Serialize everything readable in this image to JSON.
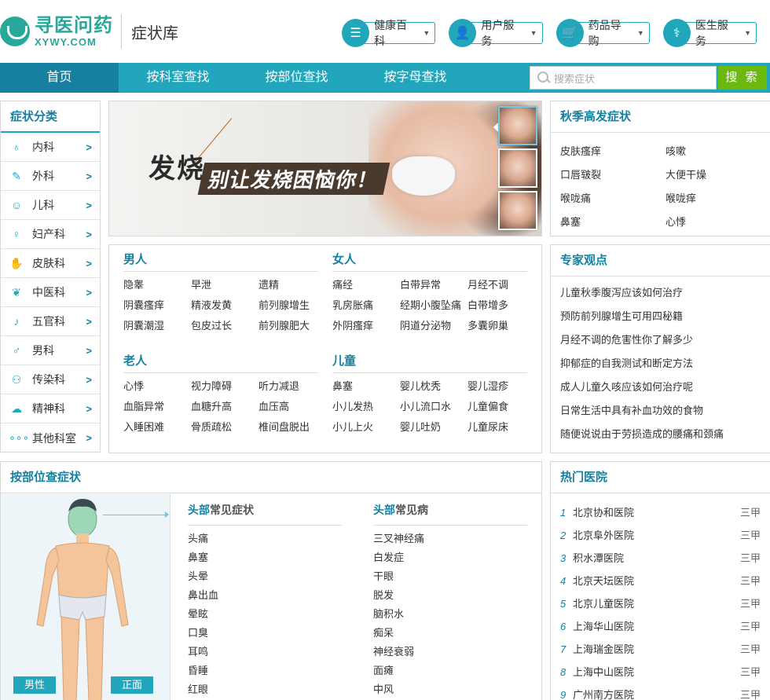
{
  "header": {
    "logo_cn": "寻医问药",
    "logo_en": "XYWY.COM",
    "site_name": "症状库",
    "top_nav": [
      {
        "label": "健康百科",
        "icon": "list-icon"
      },
      {
        "label": "用户服务",
        "icon": "user-icon"
      },
      {
        "label": "药品导购",
        "icon": "cart-icon"
      },
      {
        "label": "医生服务",
        "icon": "doctor-icon"
      }
    ]
  },
  "nav": {
    "items": [
      "首页",
      "按科室查找",
      "按部位查找",
      "按字母查找"
    ],
    "search_placeholder": "搜索症状",
    "search_button": "搜 索"
  },
  "categories": {
    "title": "症状分类",
    "items": [
      {
        "label": "内科",
        "icon": "stomach-icon"
      },
      {
        "label": "外科",
        "icon": "syringe-icon"
      },
      {
        "label": "儿科",
        "icon": "baby-icon"
      },
      {
        "label": "妇产科",
        "icon": "maternity-icon"
      },
      {
        "label": "皮肤科",
        "icon": "skin-icon"
      },
      {
        "label": "中医科",
        "icon": "herb-icon"
      },
      {
        "label": "五官科",
        "icon": "ear-icon"
      },
      {
        "label": "男科",
        "icon": "male-icon"
      },
      {
        "label": "传染科",
        "icon": "people-icon"
      },
      {
        "label": "精神科",
        "icon": "brain-icon"
      },
      {
        "label": "其他科室",
        "icon": "more-icon"
      }
    ]
  },
  "banner": {
    "title": "发烧",
    "subtitle": "别让发烧困恼你！"
  },
  "groups": [
    {
      "title": "男人",
      "items": [
        "隐睾",
        "早泄",
        "遗精",
        "阴囊瘙痒",
        "精液发黄",
        "前列腺增生",
        "阴囊潮湿",
        "包皮过长",
        "前列腺肥大"
      ]
    },
    {
      "title": "女人",
      "items": [
        "痛经",
        "白带异常",
        "月经不调",
        "乳房胀痛",
        "经期小腹坠痛",
        "白带增多",
        "外阴瘙痒",
        "阴道分泌物",
        "多囊卵巢"
      ]
    },
    {
      "title": "老人",
      "items": [
        "心悸",
        "视力障碍",
        "听力减退",
        "血脂异常",
        "血糖升高",
        "血压高",
        "入睡困难",
        "骨质疏松",
        "椎间盘脱出"
      ]
    },
    {
      "title": "儿童",
      "items": [
        "鼻塞",
        "婴儿枕秃",
        "婴儿湿疹",
        "小儿发热",
        "小儿流口水",
        "儿童偏食",
        "小儿上火",
        "婴儿吐奶",
        "儿童尿床"
      ]
    }
  ],
  "season": {
    "title": "秋季高发症状",
    "items": [
      "皮肤瘙痒",
      "咳嗽",
      "口唇皲裂",
      "大便干燥",
      "喉咙痛",
      "喉咙痒",
      "鼻塞",
      "心悸"
    ]
  },
  "expert": {
    "title": "专家观点",
    "items": [
      "儿童秋季腹泻应该如何治疗",
      "预防前列腺增生可用四秘籍",
      "月经不调的危害性你了解多少",
      "抑郁症的自我测试和断定方法",
      "成人儿童久咳应该如何治疗呢",
      "日常生活中具有补血功效的食物",
      "随便说说由于劳损造成的腰痛和颈痛"
    ]
  },
  "body_part": {
    "title": "按部位查症状",
    "sex_button": "男性",
    "side_button": "正面",
    "symptoms_part": "头部",
    "symptoms_suffix": "常见症状",
    "symptoms": [
      "头痛",
      "鼻塞",
      "头晕",
      "鼻出血",
      "晕眩",
      "口臭",
      "耳鸣",
      "昏睡",
      "红眼"
    ],
    "diseases_part": "头部",
    "diseases_suffix": "常见病",
    "diseases": [
      "三叉神经痛",
      "白发症",
      "干眼",
      "脱发",
      "脑积水",
      "痴呆",
      "神经衰弱",
      "面瘫",
      "中风"
    ]
  },
  "hospitals": {
    "title": "热门医院",
    "items": [
      {
        "rank": "1",
        "name": "北京协和医院",
        "level": "三甲"
      },
      {
        "rank": "2",
        "name": "北京阜外医院",
        "level": "三甲"
      },
      {
        "rank": "3",
        "name": "积水潭医院",
        "level": "三甲"
      },
      {
        "rank": "4",
        "name": "北京天坛医院",
        "level": "三甲"
      },
      {
        "rank": "5",
        "name": "北京儿童医院",
        "level": "三甲"
      },
      {
        "rank": "6",
        "name": "上海华山医院",
        "level": "三甲"
      },
      {
        "rank": "7",
        "name": "上海瑞金医院",
        "level": "三甲"
      },
      {
        "rank": "8",
        "name": "上海中山医院",
        "level": "三甲"
      },
      {
        "rank": "9",
        "name": "广州南方医院",
        "level": "三甲"
      }
    ]
  },
  "colors": {
    "brand": "#27a89a",
    "primary": "#21a6bc",
    "primary_dark": "#1680a1",
    "search_button": "#6bb80f"
  }
}
